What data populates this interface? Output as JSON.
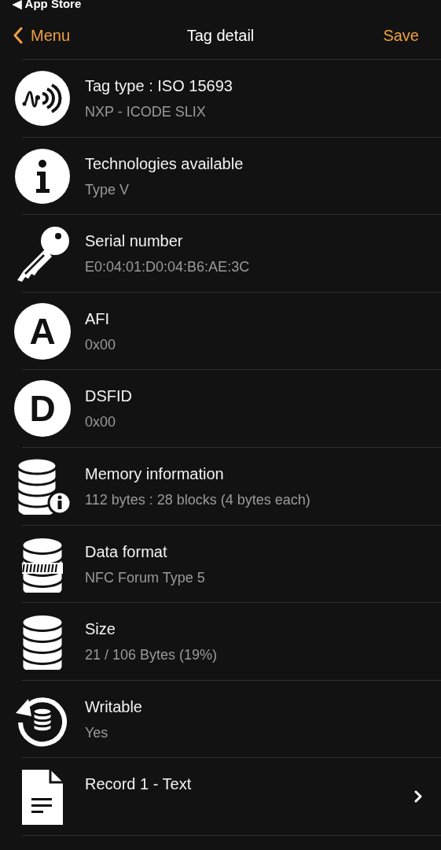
{
  "status_bar": {
    "back_app": "◀ App Store"
  },
  "nav": {
    "back": "Menu",
    "title": "Tag detail",
    "action": "Save"
  },
  "rows": [
    {
      "title": "Tag type : ISO 15693",
      "subtitle": "NXP - ICODE SLIX",
      "kind": "info"
    },
    {
      "title": "Technologies available",
      "subtitle": "Type V",
      "kind": "info"
    },
    {
      "title": "Serial number",
      "subtitle": "E0:04:01:D0:04:B6:AE:3C",
      "kind": "info"
    },
    {
      "icon_letter": "A",
      "title": "AFI",
      "subtitle": "0x00",
      "kind": "info"
    },
    {
      "icon_letter": "D",
      "title": "DSFID",
      "subtitle": "0x00",
      "kind": "info"
    },
    {
      "title": "Memory information",
      "subtitle": "112 bytes : 28 blocks (4 bytes each)",
      "kind": "info"
    },
    {
      "title": "Data format",
      "subtitle": "NFC Forum Type 5",
      "kind": "info"
    },
    {
      "title": "Size",
      "subtitle": "21 / 106 Bytes (19%)",
      "kind": "info"
    },
    {
      "title": "Writable",
      "subtitle": "Yes",
      "kind": "info"
    },
    {
      "title": "Record 1 - Text",
      "kind": "link"
    }
  ]
}
